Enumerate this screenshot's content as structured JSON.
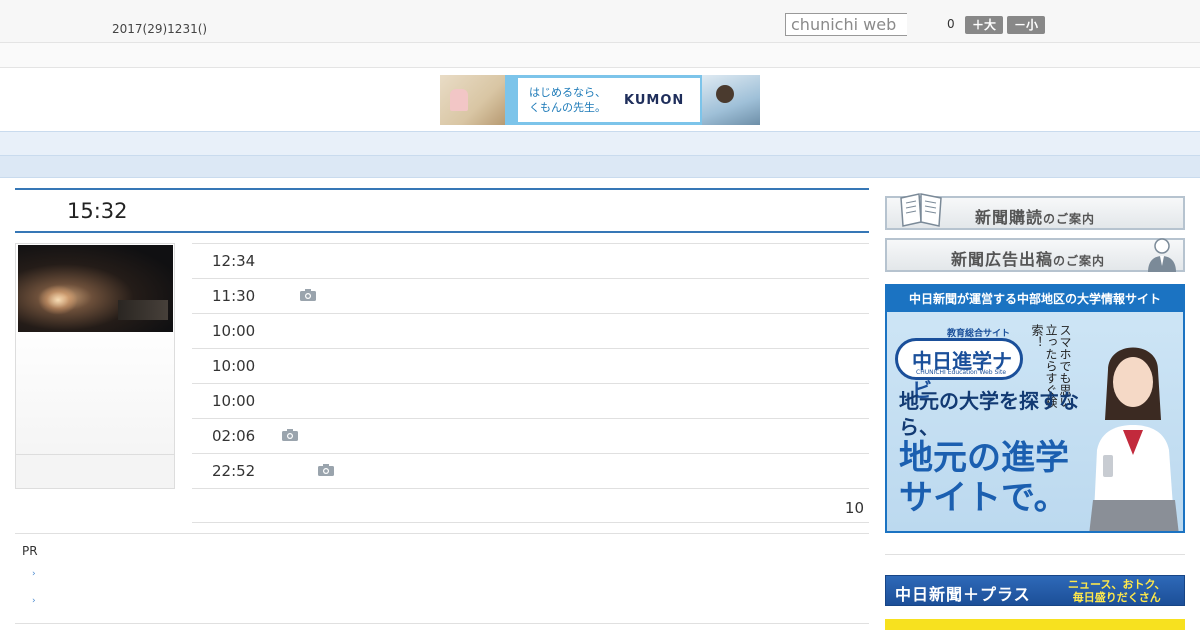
{
  "header": {
    "date": "2017(29)1231()",
    "search_placeholder": "chunichi web",
    "count": "0",
    "font_large_label": "＋大",
    "font_small_label": "－小"
  },
  "banner": {
    "text_line1": "はじめるなら、",
    "text_line2": "くもんの先生。",
    "logo": "KUMON"
  },
  "nav": {
    "items": [
      "",
      "",
      "",
      "",
      "",
      "",
      "",
      "",
      ""
    ]
  },
  "headline": {
    "time": "15:32"
  },
  "articles": [
    {
      "time": "12:34",
      "has_photo": false
    },
    {
      "time": "11:30",
      "has_photo": true
    },
    {
      "time": "10:00",
      "has_photo": false
    },
    {
      "time": "10:00",
      "has_photo": false
    },
    {
      "time": "10:00",
      "has_photo": false
    },
    {
      "time": "02:06",
      "has_photo": true
    },
    {
      "time": "22:52",
      "has_photo": true
    }
  ],
  "more_count": "10",
  "pr": {
    "label": "PR"
  },
  "sidebar": {
    "subscribe_main": "新聞購読",
    "subscribe_suffix": "のご案内",
    "advert_main": "新聞広告出稿",
    "advert_suffix": "のご案内",
    "ad_header": "中日新聞が運営する中部地区の大学情報サイト",
    "ad_logo_small": "教育総合サイト",
    "ad_logo_text": "中日進学ナビ",
    "ad_logo_sub": "CHUNICHI Education Web Site",
    "ad_side_text": "スマホでも思い立ったらすぐ検索！",
    "ad_line1": "地元の大学を探すなら、",
    "ad_line2": "地元の進学サイトで。",
    "plus_left": "中日新聞＋プラス",
    "plus_right_1": "ニュース、おトク、",
    "plus_right_2": "毎日盛りだくさん"
  },
  "colors": {
    "accent": "#3677b6",
    "nav_bg": "#e8f0f9",
    "ad_blue": "#1b73c2",
    "plus_yellow": "#f7e11f"
  }
}
